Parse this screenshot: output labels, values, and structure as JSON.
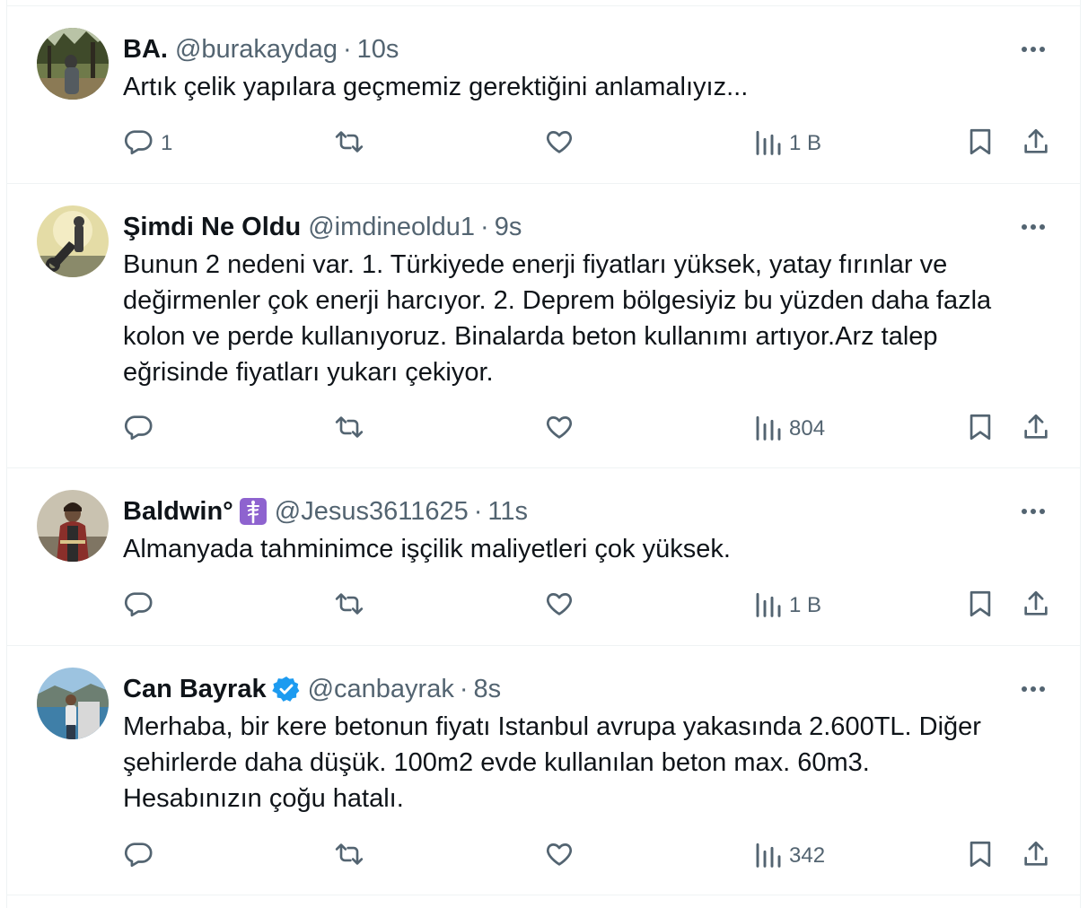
{
  "icons": {
    "more": "more-horizontal-icon",
    "reply": "reply-bubble-icon",
    "retweet": "retweet-icon",
    "like": "heart-icon",
    "views": "analytics-bars-icon",
    "bookmark": "bookmark-icon",
    "share": "share-upload-icon",
    "verified": "verified-badge-icon",
    "emoji": "medical-symbol-emoji-icon"
  },
  "colors": {
    "text": "#0f1419",
    "secondary": "#536471",
    "border": "#eff3f4",
    "verified": "#1d9bf0",
    "emoji_bg": "#8e63cf"
  },
  "tweets": [
    {
      "name": "BA.",
      "handle": "@burakaydag",
      "separator": "·",
      "time": "10s",
      "text": "Artık çelik yapılara geçmemiz gerektiğini anlamalıyız...",
      "reply_count": "1",
      "retweet_count": "",
      "like_count": "",
      "views": "1 B"
    },
    {
      "name": "Şimdi Ne Oldu",
      "handle": "@imdineoldu1",
      "separator": "·",
      "time": "9s",
      "text": "Bunun 2 nedeni var. 1. Türkiyede enerji fiyatları yüksek, yatay fırınlar ve\ndeğirmenler çok enerji harcıyor. 2. Deprem bölgesiyiz bu yüzden daha fazla\nkolon ve perde kullanıyoruz. Binalarda beton kullanımı artıyor.Arz talep\neğrisinde fiyatları yukarı çekiyor.",
      "reply_count": "",
      "retweet_count": "",
      "like_count": "",
      "views": "804"
    },
    {
      "name": "Baldwin°",
      "handle": "@Jesus3611625",
      "separator": "·",
      "time": "11s",
      "text": "Almanyada tahminimce işçilik maliyetleri çok yüksek.",
      "reply_count": "",
      "retweet_count": "",
      "like_count": "",
      "views": "1 B"
    },
    {
      "name": "Can Bayrak",
      "handle": "@canbayrak",
      "separator": "·",
      "time": "8s",
      "text": "Merhaba, bir kere betonun fiyatı Istanbul avrupa yakasında 2.600TL. Diğer\nşehirlerde daha düşük. 100m2 evde kullanılan beton max. 60m3.\nHesabınızın çoğu hatalı.",
      "reply_count": "",
      "retweet_count": "",
      "like_count": "",
      "views": "342"
    }
  ]
}
